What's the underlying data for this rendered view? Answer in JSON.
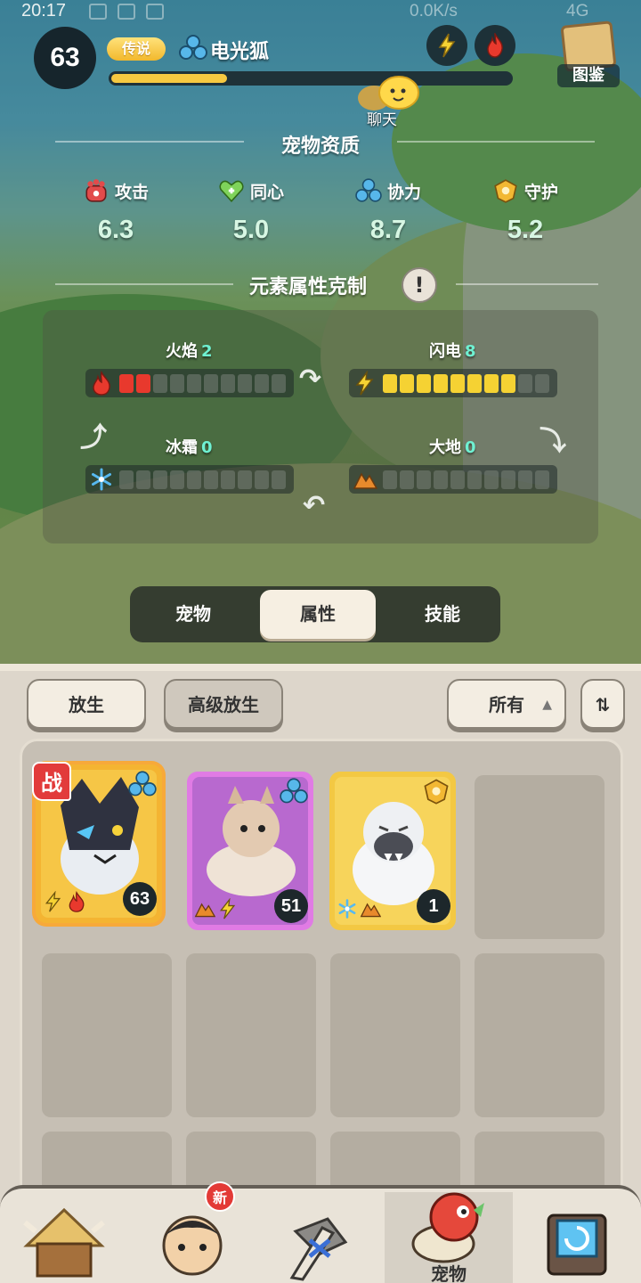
{
  "status_bar": {
    "time": "20:17",
    "network_speed": "0.0K/s",
    "network_type": "4G"
  },
  "header": {
    "level": "63",
    "rarity": "传说",
    "pet_name": "电光狐",
    "xp_progress": 0.29,
    "codex_label": "图鉴",
    "chat_label": "聊天"
  },
  "aptitude": {
    "title": "宠物资质",
    "stats": [
      {
        "label": "攻击",
        "value": "6.3",
        "icon": "attack-paw-icon",
        "color": "#e24b4b"
      },
      {
        "label": "同心",
        "value": "5.0",
        "icon": "heart-icon",
        "color": "#7fd35a"
      },
      {
        "label": "协力",
        "value": "8.7",
        "icon": "teamwork-icon",
        "color": "#4fb6e8"
      },
      {
        "label": "守护",
        "value": "5.2",
        "icon": "guard-icon",
        "color": "#f2b833"
      }
    ]
  },
  "elements": {
    "title": "元素属性克制",
    "items": [
      {
        "name": "火焰",
        "level": "2",
        "filled": 2,
        "total": 10,
        "color": "#e8392d",
        "icon": "fire-icon"
      },
      {
        "name": "闪电",
        "level": "8",
        "filled": 8,
        "total": 10,
        "color": "#f5d233",
        "icon": "lightning-icon"
      },
      {
        "name": "冰霜",
        "level": "0",
        "filled": 0,
        "total": 10,
        "color": "#57b9f0",
        "icon": "snowflake-icon"
      },
      {
        "name": "大地",
        "level": "0",
        "filled": 0,
        "total": 10,
        "color": "#e88a2c",
        "icon": "earth-icon"
      }
    ]
  },
  "tabs": {
    "items": [
      "宠物",
      "属性",
      "技能"
    ],
    "active": "属性"
  },
  "toolbar": {
    "release_label": "放生",
    "advanced_release_label": "高级放生",
    "filter_value": "所有"
  },
  "pets": [
    {
      "level": "63",
      "type": "teamwork",
      "elements": [
        "lightning",
        "fire"
      ],
      "in_battle": true,
      "battle_label": "战",
      "frame": "#f4b432",
      "bg": "#f6c646"
    },
    {
      "level": "51",
      "type": "teamwork",
      "elements": [
        "earth",
        "lightning"
      ],
      "in_battle": false,
      "frame": "#e07be4",
      "bg": "#b869cf"
    },
    {
      "level": "1",
      "type": "guard",
      "elements": [
        "snowflake",
        "earth"
      ],
      "in_battle": false,
      "frame": "#f3c843",
      "bg": "#f7d45b"
    }
  ],
  "bottom_nav": {
    "active_label": "宠物",
    "new_badge": "新"
  }
}
